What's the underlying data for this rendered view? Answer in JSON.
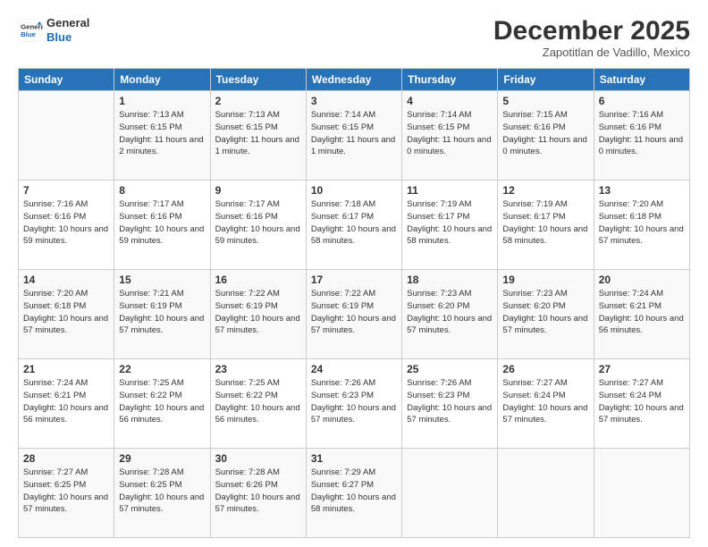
{
  "header": {
    "logo_line1": "General",
    "logo_line2": "Blue",
    "month": "December 2025",
    "location": "Zapotitlan de Vadillo, Mexico"
  },
  "weekdays": [
    "Sunday",
    "Monday",
    "Tuesday",
    "Wednesday",
    "Thursday",
    "Friday",
    "Saturday"
  ],
  "weeks": [
    [
      {
        "day": "",
        "sunrise": "",
        "sunset": "",
        "daylight": ""
      },
      {
        "day": "1",
        "sunrise": "7:13 AM",
        "sunset": "6:15 PM",
        "daylight": "11 hours and 2 minutes."
      },
      {
        "day": "2",
        "sunrise": "7:13 AM",
        "sunset": "6:15 PM",
        "daylight": "11 hours and 1 minute."
      },
      {
        "day": "3",
        "sunrise": "7:14 AM",
        "sunset": "6:15 PM",
        "daylight": "11 hours and 1 minute."
      },
      {
        "day": "4",
        "sunrise": "7:14 AM",
        "sunset": "6:15 PM",
        "daylight": "11 hours and 0 minutes."
      },
      {
        "day": "5",
        "sunrise": "7:15 AM",
        "sunset": "6:16 PM",
        "daylight": "11 hours and 0 minutes."
      },
      {
        "day": "6",
        "sunrise": "7:16 AM",
        "sunset": "6:16 PM",
        "daylight": "11 hours and 0 minutes."
      }
    ],
    [
      {
        "day": "7",
        "sunrise": "7:16 AM",
        "sunset": "6:16 PM",
        "daylight": "10 hours and 59 minutes."
      },
      {
        "day": "8",
        "sunrise": "7:17 AM",
        "sunset": "6:16 PM",
        "daylight": "10 hours and 59 minutes."
      },
      {
        "day": "9",
        "sunrise": "7:17 AM",
        "sunset": "6:16 PM",
        "daylight": "10 hours and 59 minutes."
      },
      {
        "day": "10",
        "sunrise": "7:18 AM",
        "sunset": "6:17 PM",
        "daylight": "10 hours and 58 minutes."
      },
      {
        "day": "11",
        "sunrise": "7:19 AM",
        "sunset": "6:17 PM",
        "daylight": "10 hours and 58 minutes."
      },
      {
        "day": "12",
        "sunrise": "7:19 AM",
        "sunset": "6:17 PM",
        "daylight": "10 hours and 58 minutes."
      },
      {
        "day": "13",
        "sunrise": "7:20 AM",
        "sunset": "6:18 PM",
        "daylight": "10 hours and 57 minutes."
      }
    ],
    [
      {
        "day": "14",
        "sunrise": "7:20 AM",
        "sunset": "6:18 PM",
        "daylight": "10 hours and 57 minutes."
      },
      {
        "day": "15",
        "sunrise": "7:21 AM",
        "sunset": "6:19 PM",
        "daylight": "10 hours and 57 minutes."
      },
      {
        "day": "16",
        "sunrise": "7:22 AM",
        "sunset": "6:19 PM",
        "daylight": "10 hours and 57 minutes."
      },
      {
        "day": "17",
        "sunrise": "7:22 AM",
        "sunset": "6:19 PM",
        "daylight": "10 hours and 57 minutes."
      },
      {
        "day": "18",
        "sunrise": "7:23 AM",
        "sunset": "6:20 PM",
        "daylight": "10 hours and 57 minutes."
      },
      {
        "day": "19",
        "sunrise": "7:23 AM",
        "sunset": "6:20 PM",
        "daylight": "10 hours and 57 minutes."
      },
      {
        "day": "20",
        "sunrise": "7:24 AM",
        "sunset": "6:21 PM",
        "daylight": "10 hours and 56 minutes."
      }
    ],
    [
      {
        "day": "21",
        "sunrise": "7:24 AM",
        "sunset": "6:21 PM",
        "daylight": "10 hours and 56 minutes."
      },
      {
        "day": "22",
        "sunrise": "7:25 AM",
        "sunset": "6:22 PM",
        "daylight": "10 hours and 56 minutes."
      },
      {
        "day": "23",
        "sunrise": "7:25 AM",
        "sunset": "6:22 PM",
        "daylight": "10 hours and 56 minutes."
      },
      {
        "day": "24",
        "sunrise": "7:26 AM",
        "sunset": "6:23 PM",
        "daylight": "10 hours and 57 minutes."
      },
      {
        "day": "25",
        "sunrise": "7:26 AM",
        "sunset": "6:23 PM",
        "daylight": "10 hours and 57 minutes."
      },
      {
        "day": "26",
        "sunrise": "7:27 AM",
        "sunset": "6:24 PM",
        "daylight": "10 hours and 57 minutes."
      },
      {
        "day": "27",
        "sunrise": "7:27 AM",
        "sunset": "6:24 PM",
        "daylight": "10 hours and 57 minutes."
      }
    ],
    [
      {
        "day": "28",
        "sunrise": "7:27 AM",
        "sunset": "6:25 PM",
        "daylight": "10 hours and 57 minutes."
      },
      {
        "day": "29",
        "sunrise": "7:28 AM",
        "sunset": "6:25 PM",
        "daylight": "10 hours and 57 minutes."
      },
      {
        "day": "30",
        "sunrise": "7:28 AM",
        "sunset": "6:26 PM",
        "daylight": "10 hours and 57 minutes."
      },
      {
        "day": "31",
        "sunrise": "7:29 AM",
        "sunset": "6:27 PM",
        "daylight": "10 hours and 58 minutes."
      },
      {
        "day": "",
        "sunrise": "",
        "sunset": "",
        "daylight": ""
      },
      {
        "day": "",
        "sunrise": "",
        "sunset": "",
        "daylight": ""
      },
      {
        "day": "",
        "sunrise": "",
        "sunset": "",
        "daylight": ""
      }
    ]
  ]
}
